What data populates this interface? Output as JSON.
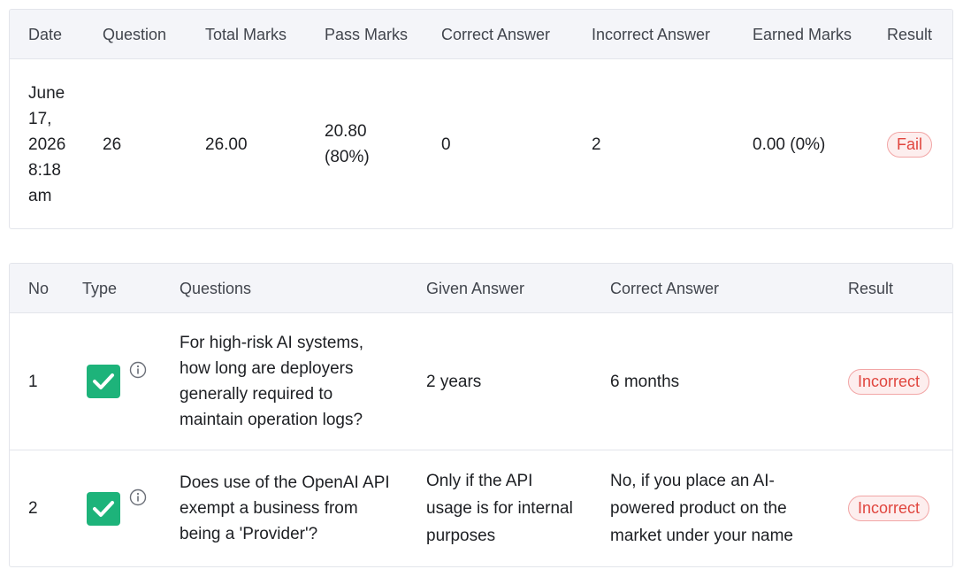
{
  "summary": {
    "headers": {
      "date": "Date",
      "question": "Question",
      "total_marks": "Total Marks",
      "pass_marks": "Pass Marks",
      "correct_answer": "Correct Answer",
      "incorrect_answer": "Incorrect Answer",
      "earned_marks": "Earned Marks",
      "result": "Result"
    },
    "row": {
      "date_lines": [
        "June",
        "17,",
        "2026",
        "8:18",
        "am"
      ],
      "question": "26",
      "total_marks": "26.00",
      "pass_marks_lines": [
        "20.80",
        "(80%)"
      ],
      "correct_answer": "0",
      "incorrect_answer": "2",
      "earned_marks": "0.00 (0%)",
      "result": "Fail"
    }
  },
  "details": {
    "headers": {
      "no": "No",
      "type": "Type",
      "questions": "Questions",
      "given_answer": "Given Answer",
      "correct_answer": "Correct Answer",
      "result": "Result"
    },
    "rows": [
      {
        "no": "1",
        "type_icon": "check-icon",
        "question_lines": [
          "For high-risk AI systems,",
          "how long are deployers",
          "generally required to",
          "maintain operation logs?"
        ],
        "given_answer_lines": [
          "2 years"
        ],
        "correct_answer_lines": [
          "6 months"
        ],
        "result": "Incorrect"
      },
      {
        "no": "2",
        "type_icon": "check-icon",
        "question_lines": [
          "Does use of the OpenAI API",
          "exempt a business from",
          "being a 'Provider'?"
        ],
        "given_answer_lines": [
          "Only if the API",
          "usage is for internal",
          "purposes"
        ],
        "correct_answer_lines": [
          "No, if you place an AI-",
          "powered product on the",
          "market under your name"
        ],
        "result": "Incorrect"
      }
    ]
  },
  "colors": {
    "accent_green": "#1db37a",
    "fail_red": "#e0463f",
    "header_bg": "#f4f5f9"
  }
}
